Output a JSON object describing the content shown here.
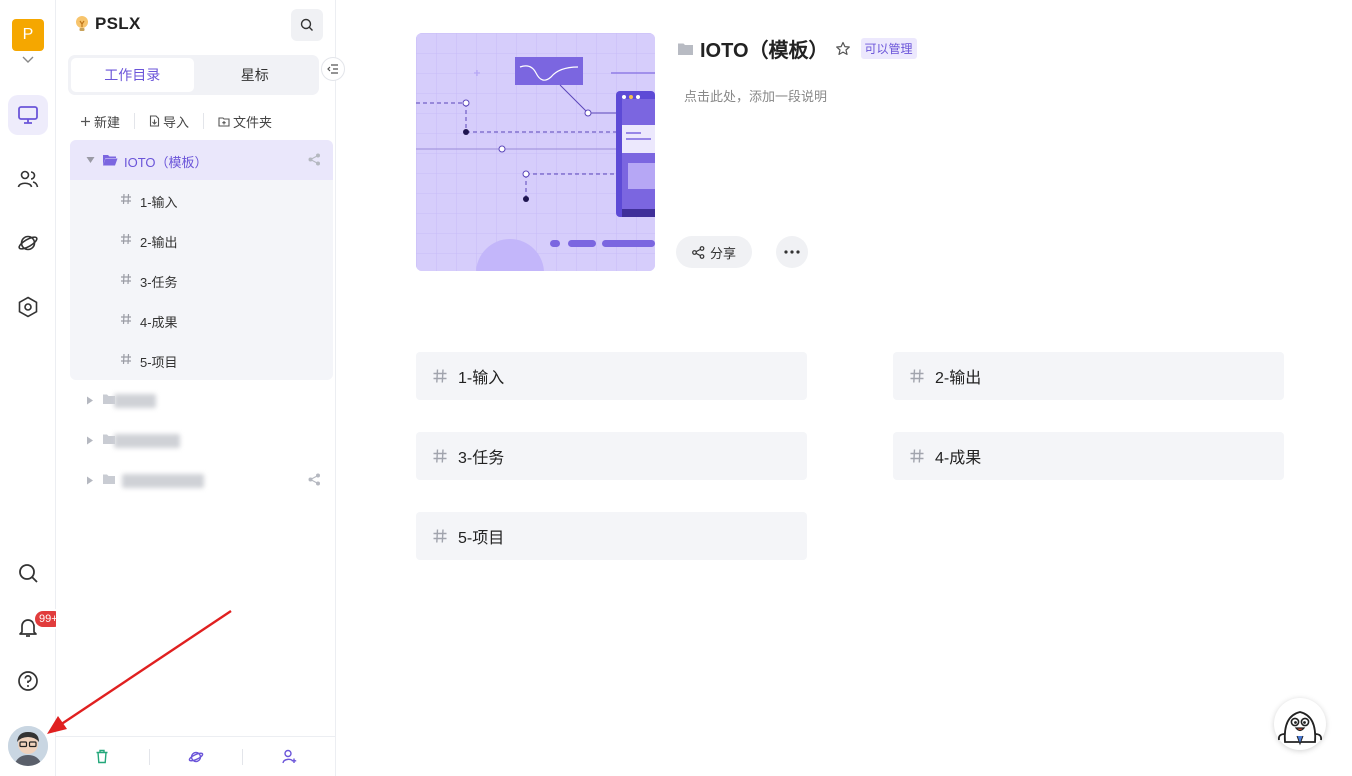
{
  "rail": {
    "workspace_initial": "P",
    "nav_items": [
      "desktop-icon",
      "team-icon",
      "planet-icon",
      "hexagon-settings-icon"
    ],
    "notification_count": "99+",
    "bottom_items": [
      "search-icon",
      "bell-icon",
      "help-icon"
    ]
  },
  "sidebar": {
    "brand": "PSLX",
    "tabs": [
      {
        "label": "工作目录",
        "active": true
      },
      {
        "label": "星标",
        "active": false
      }
    ],
    "toolbar": {
      "new_label": "新建",
      "import_label": "导入",
      "folder_label": "文件夹"
    },
    "tree": {
      "open_folder": "IOTO（模板）",
      "children": [
        "1-输入",
        "2-输出",
        "3-任务",
        "4-成果",
        "5-项目"
      ]
    },
    "bottom_bar": [
      "trash-icon",
      "planet-icon",
      "add-user-icon"
    ]
  },
  "main": {
    "title": "IOTO（模板）",
    "permission_badge": "可以管理",
    "description_placeholder": "点击此处，添加一段说明",
    "share_label": "分享",
    "cards": [
      "1-输入",
      "2-输出",
      "3-任务",
      "4-成果",
      "5-项目"
    ]
  },
  "colors": {
    "accent": "#6b55d9",
    "accent_light": "#eae7fb",
    "cover_bg": "#d6cdfb",
    "notification_red": "#e13c3c",
    "workspace_orange": "#f5a700"
  }
}
